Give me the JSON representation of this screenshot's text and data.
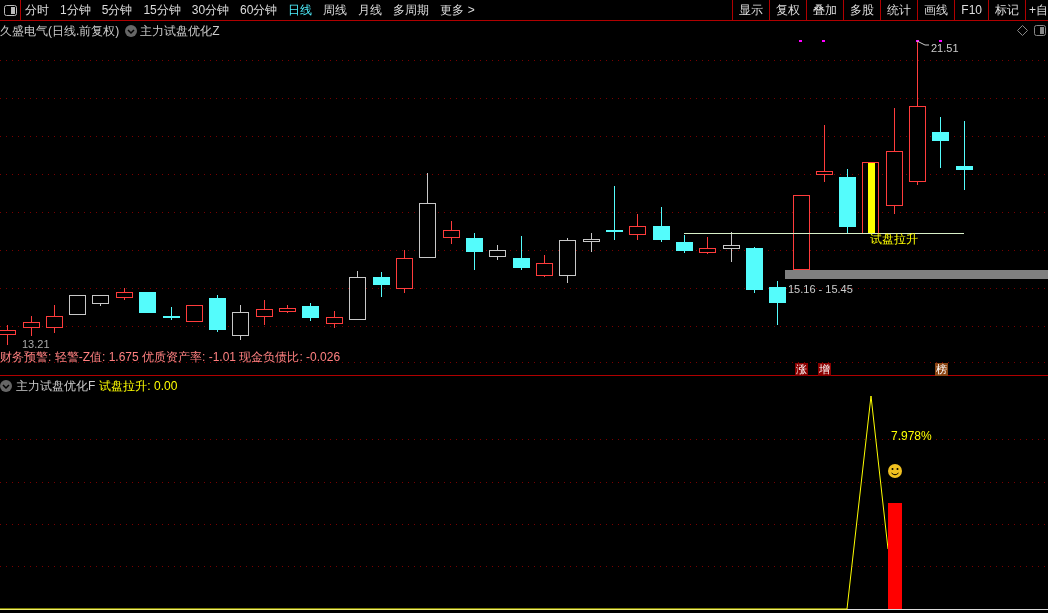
{
  "toolbar": {
    "periods": [
      {
        "label": "分时",
        "selected": false
      },
      {
        "label": "1分钟",
        "selected": false
      },
      {
        "label": "5分钟",
        "selected": false
      },
      {
        "label": "15分钟",
        "selected": false
      },
      {
        "label": "30分钟",
        "selected": false
      },
      {
        "label": "60分钟",
        "selected": false
      },
      {
        "label": "日线",
        "selected": true
      },
      {
        "label": "周线",
        "selected": false
      },
      {
        "label": "月线",
        "selected": false
      },
      {
        "label": "多周期",
        "selected": false
      },
      {
        "label": "更多 >",
        "selected": false
      }
    ],
    "buttons": [
      "显示",
      "复权",
      "叠加",
      "多股",
      "统计",
      "画线",
      "F10",
      "标记",
      "+自"
    ]
  },
  "chart_header": {
    "stock": "久盛电气(日线.前复权)",
    "indicator": "主力试盘优化Z"
  },
  "price_labels": {
    "high": "21.51",
    "low": "13.21",
    "range": "15.16 - 15.45"
  },
  "signal_label": "试盘拉升",
  "finance_warning": "财务预警: 轻警-Z值: 1.675 优质资产率: -1.01 现金负债比: -0.026",
  "event_markers": [
    {
      "label": "涨",
      "color": "#8b0000"
    },
    {
      "label": "增",
      "color": "#8b0000"
    },
    {
      "label": "榜",
      "color": "#8b4513"
    }
  ],
  "sub_panel": {
    "indicator": "主力试盘优化F",
    "value_label": "试盘拉升: 0.00",
    "percent": "7.978%"
  }
}
